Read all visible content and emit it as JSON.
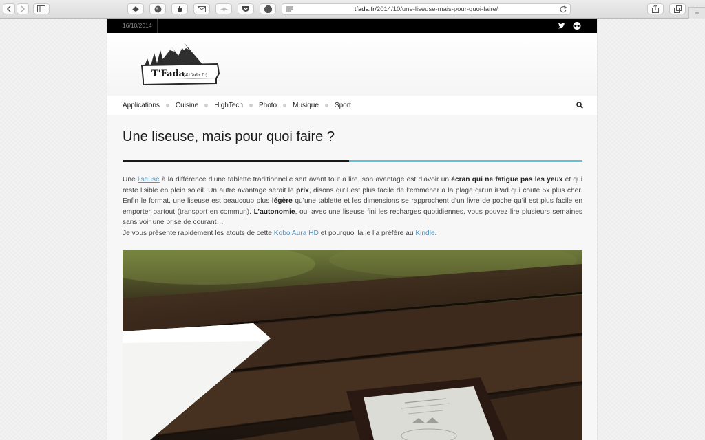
{
  "browser": {
    "url_host": "tfada.fr",
    "url_path": "/2014/10/une-liseuse-mais-pour-quoi-faire/",
    "new_tab_glyph": "+",
    "icons": [
      "back-icon",
      "forward-icon",
      "sidebar-icon",
      "extension-icon",
      "globe-icon",
      "hand-icon",
      "mail-icon",
      "puzzle-icon",
      "pocket-icon",
      "adblock-icon",
      "reader-icon",
      "reload-icon",
      "share-icon",
      "tabs-icon"
    ]
  },
  "site": {
    "date": "16/10/2014",
    "logo_name": "T'Fada",
    "logo_handle": "(#tfada.fr)",
    "nav": [
      "Applications",
      "Cuisine",
      "HighTech",
      "Photo",
      "Musique",
      "Sport"
    ]
  },
  "article": {
    "title": "Une liseuse, mais pour quoi faire ?",
    "p1": {
      "t1": "Une ",
      "link1": "liseuse",
      "t2": " à la différence d’une tablette traditionnelle sert avant tout à lire, son avantage est d’avoir un ",
      "b1": "écran qui ne fatigue pas les yeux",
      "t3": " et qui reste lisible en plein soleil. Un autre avantage serait le ",
      "b2": "prix",
      "t4": ", disons qu’il est plus facile de l’emmener à la plage qu’un iPad qui coute 5x plus cher. Enfin le format, une liseuse est beaucoup plus ",
      "b3": "légère",
      "t5": " qu’une tablette et les dimensions se rapprochent d’un livre de poche qu’il est plus facile en emporter partout (transport en commun). ",
      "b4": "L’autonomie",
      "t6": ", oui avec une liseuse fini les recharges quotidiennes, vous pouvez lire plusieurs semaines sans voir une prise de courant…"
    },
    "p2": {
      "t1": "Je vous présente rapidement les atouts de cette ",
      "link1": "Kobo Aura HD",
      "t2": " et pourquoi la je l’a préfère au ",
      "link2": "Kindle",
      "t3": "."
    }
  },
  "colors": {
    "accent": "#5cc3d6",
    "link": "#4a95c8",
    "topbar": "#000000"
  }
}
